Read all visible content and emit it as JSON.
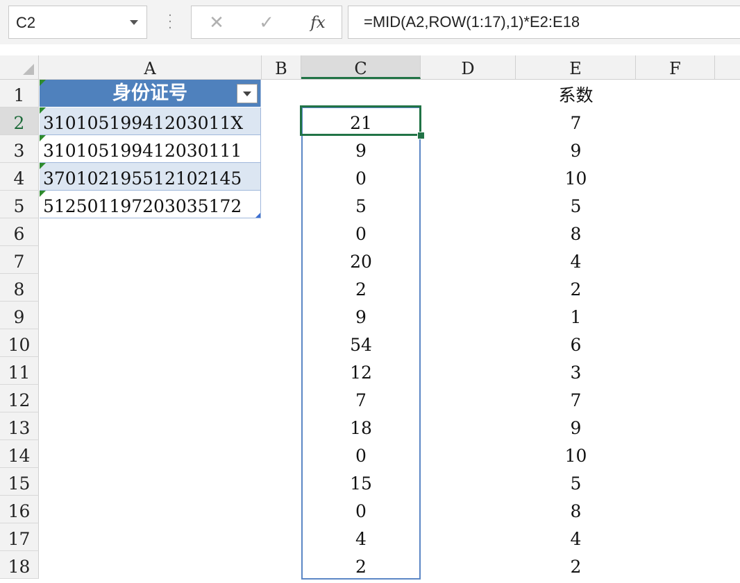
{
  "formula_bar": {
    "name_box": "C2",
    "cancel_icon": "✕",
    "enter_icon": "✓",
    "fx_label": "fx",
    "formula": "=MID(A2,ROW(1:17),1)*E2:E18"
  },
  "columns": [
    "A",
    "B",
    "C",
    "D",
    "E",
    "F"
  ],
  "rows": [
    "1",
    "2",
    "3",
    "4",
    "5",
    "6",
    "7",
    "8",
    "9",
    "10",
    "11",
    "12",
    "13",
    "14",
    "15",
    "16",
    "17",
    "18"
  ],
  "table": {
    "header": "身份证号",
    "ids": [
      "31010519941203011X",
      "310105199412030111",
      "370102195512102145",
      "512501197203035172"
    ]
  },
  "col_c_values": [
    "21",
    "9",
    "0",
    "5",
    "0",
    "20",
    "2",
    "9",
    "54",
    "12",
    "7",
    "18",
    "0",
    "15",
    "0",
    "4",
    "2"
  ],
  "col_e_header": "系数",
  "col_e_values": [
    "7",
    "9",
    "10",
    "5",
    "8",
    "4",
    "2",
    "1",
    "6",
    "3",
    "7",
    "9",
    "10",
    "5",
    "8",
    "4",
    "2"
  ],
  "colors": {
    "table_header": "#4f81bd",
    "band": "#dce6f2",
    "selection": "#217346",
    "range_outline": "#5b86c5"
  }
}
